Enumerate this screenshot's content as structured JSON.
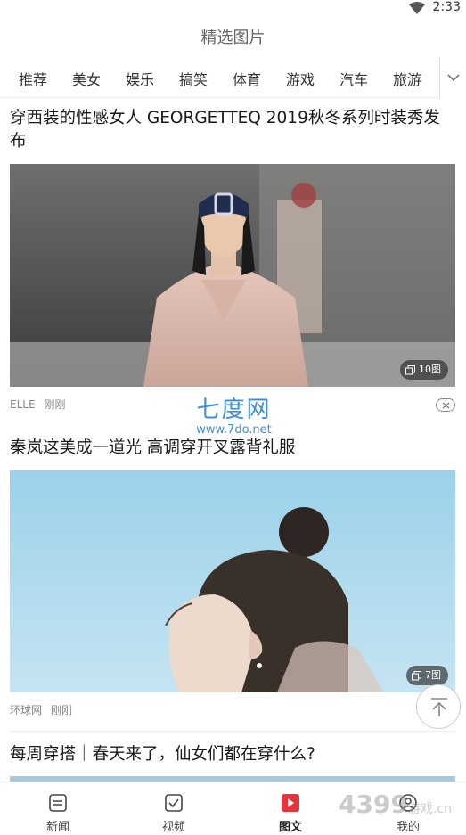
{
  "status": {
    "time": "2:33"
  },
  "header": {
    "title": "精选图片"
  },
  "tabs": [
    {
      "label": "推荐"
    },
    {
      "label": "美女"
    },
    {
      "label": "娱乐"
    },
    {
      "label": "搞笑"
    },
    {
      "label": "体育"
    },
    {
      "label": "游戏"
    },
    {
      "label": "汽车"
    },
    {
      "label": "旅游"
    }
  ],
  "articles": [
    {
      "title": "穿西装的性感女人 GEORGETTEQ 2019秋冬系列时装秀发布",
      "image_count": "10图",
      "source": "ELLE",
      "time": "刚刚"
    },
    {
      "title": "秦岚这美成一道光 高调穿开叉露背礼服",
      "image_count": "7图",
      "source": "环球网",
      "time": "刚刚"
    },
    {
      "title": "每周穿搭｜春天来了，仙女们都在穿什么?"
    }
  ],
  "watermark": {
    "main": "七度网",
    "sub": "www.7do.net"
  },
  "corner_watermark": {
    "main": "4399",
    "sub": "游戏.cn"
  },
  "bottom_nav": [
    {
      "label": "新闻",
      "icon": "news-icon"
    },
    {
      "label": "视频",
      "icon": "video-icon"
    },
    {
      "label": "图文",
      "icon": "gallery-icon",
      "active": true
    },
    {
      "label": "我的",
      "icon": "profile-icon"
    }
  ],
  "colors": {
    "accent": "#e8323c",
    "watermark": "#3a8fd8"
  }
}
